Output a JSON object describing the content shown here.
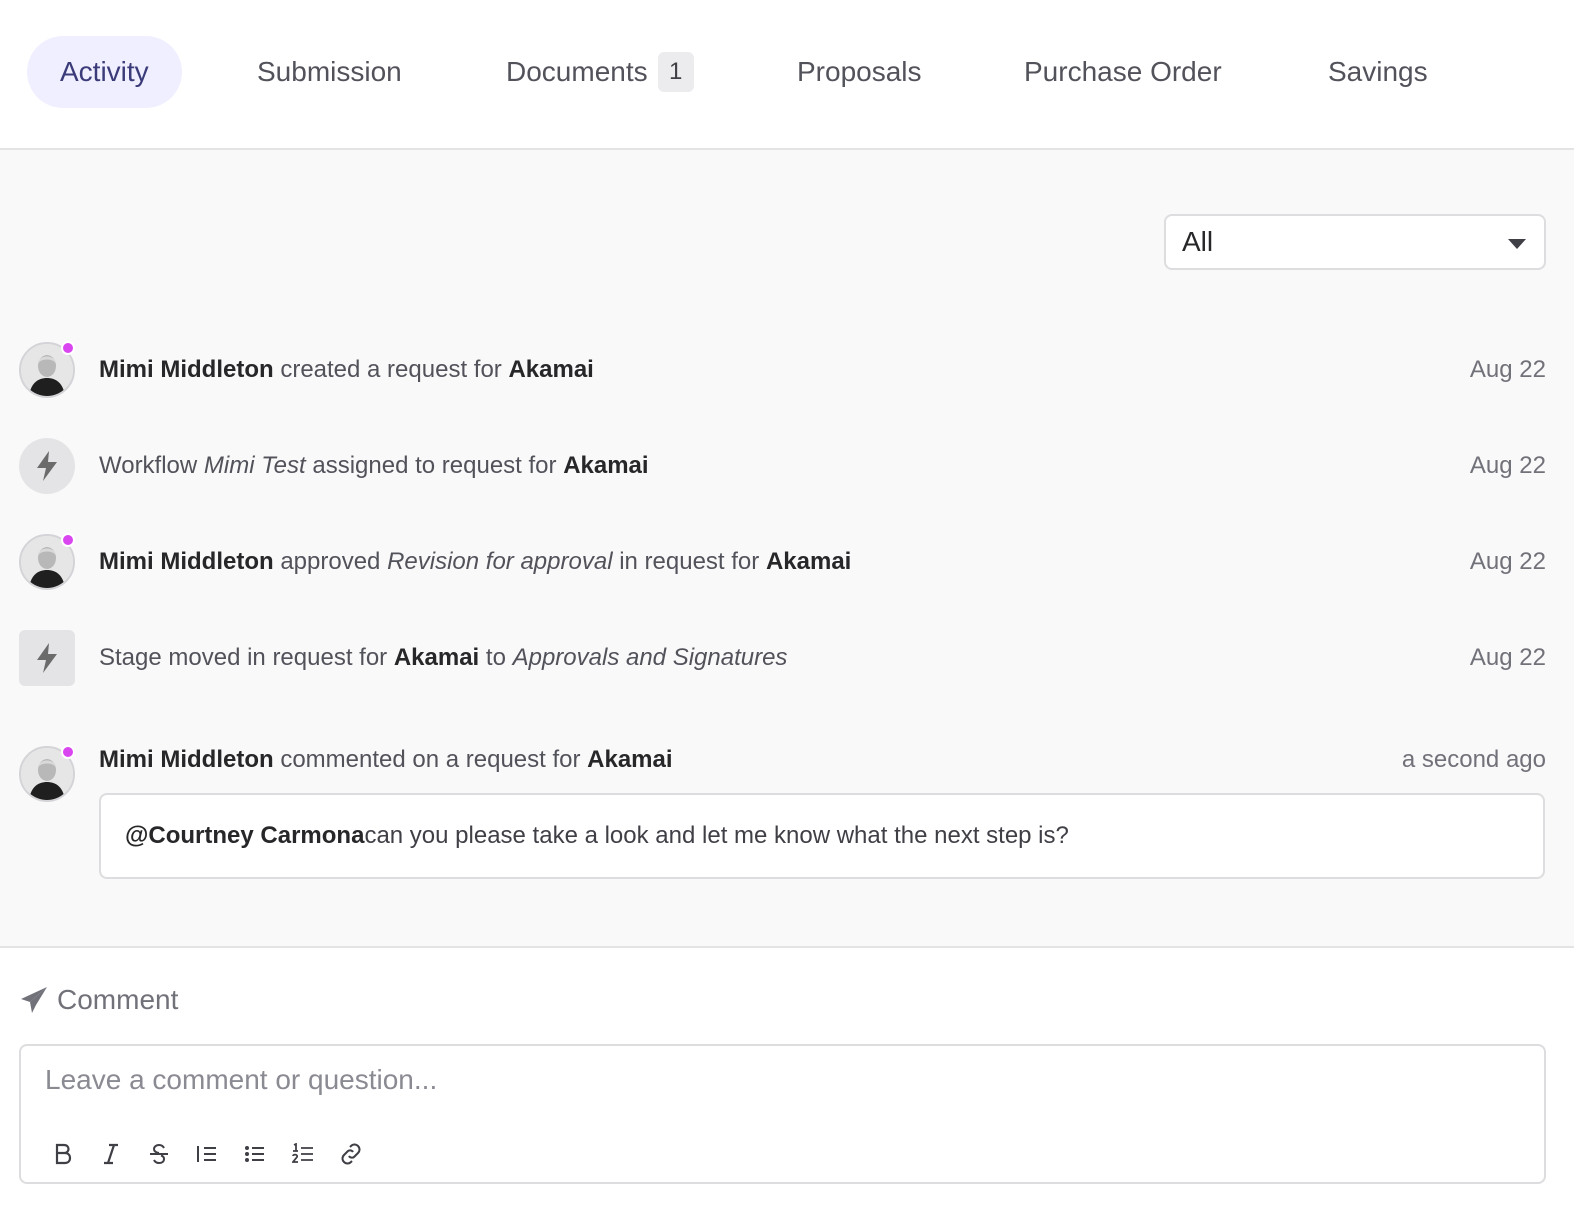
{
  "tabs": [
    {
      "label": "Activity"
    },
    {
      "label": "Submission"
    },
    {
      "label": "Documents",
      "count": "1"
    },
    {
      "label": "Proposals"
    },
    {
      "label": "Purchase Order"
    },
    {
      "label": "Savings"
    }
  ],
  "filter": {
    "value": "All"
  },
  "feed": {
    "items": [
      {
        "actor": "Mimi Middleton",
        "verb": " created a request for ",
        "target": "Akamai",
        "time": "Aug 22"
      },
      {
        "prefix": "Workflow ",
        "workflow": "Mimi Test",
        "verb": " assigned to request for ",
        "target": "Akamai",
        "time": "Aug 22"
      },
      {
        "actor": "Mimi Middleton",
        "verb": " approved ",
        "subject": "Revision for approval",
        "verb2": " in request for ",
        "target": "Akamai",
        "time": "Aug 22"
      },
      {
        "prefix": "Stage moved in request for ",
        "target": "Akamai",
        "verb": " to ",
        "stage": "Approvals and Signatures",
        "time": "Aug 22"
      },
      {
        "actor": "Mimi Middleton",
        "verb": " commented on a request for ",
        "target": "Akamai",
        "time": "a second ago",
        "comment": {
          "mention": "@Courtney Carmona",
          "body": " can you please take a look and let me know what the next step is?"
        }
      }
    ]
  },
  "composer": {
    "title": "Comment",
    "placeholder": "Leave a comment or question...",
    "tools": [
      "bold-icon",
      "italic-icon",
      "strikethrough-icon",
      "indent-icon",
      "bulleted-list-icon",
      "numbered-list-icon",
      "link-icon"
    ]
  },
  "colors": {
    "accent_bg": "#efefff",
    "accent_text": "#3b3b7a",
    "presence_dot": "#d946ef"
  }
}
